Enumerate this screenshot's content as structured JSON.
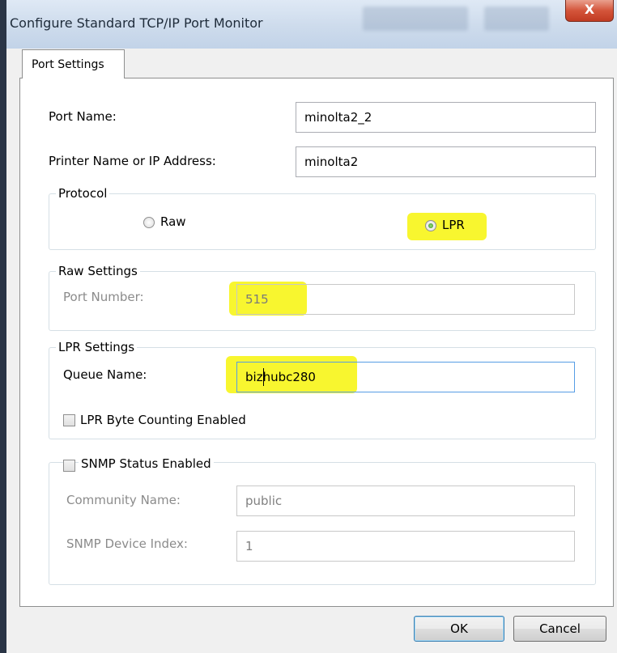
{
  "window": {
    "title": "Configure Standard TCP/IP Port Monitor",
    "close_label": "X"
  },
  "tabs": [
    {
      "label": "Port Settings"
    }
  ],
  "port": {
    "name_label": "Port Name:",
    "name_value": "minolta2_2",
    "printer_label": "Printer Name or IP Address:",
    "printer_value": "minolta2"
  },
  "protocol": {
    "title": "Protocol",
    "options": [
      {
        "label": "Raw",
        "selected": false
      },
      {
        "label": "LPR",
        "selected": true
      }
    ]
  },
  "raw_settings": {
    "title": "Raw Settings",
    "port_number_label": "Port Number:",
    "port_number_value": "515"
  },
  "lpr_settings": {
    "title": "LPR Settings",
    "queue_label": "Queue Name:",
    "queue_value": "bizhubc280",
    "byte_counting_label": "LPR Byte Counting Enabled",
    "byte_counting_checked": false
  },
  "snmp": {
    "title": "SNMP Status Enabled",
    "checked": false,
    "community_label": "Community Name:",
    "community_value": "public",
    "device_index_label": "SNMP Device Index:",
    "device_index_value": "1"
  },
  "buttons": {
    "ok": "OK",
    "cancel": "Cancel"
  },
  "colors": {
    "highlight": "#f7f40a",
    "radio_selected": "#2f8a1c"
  }
}
